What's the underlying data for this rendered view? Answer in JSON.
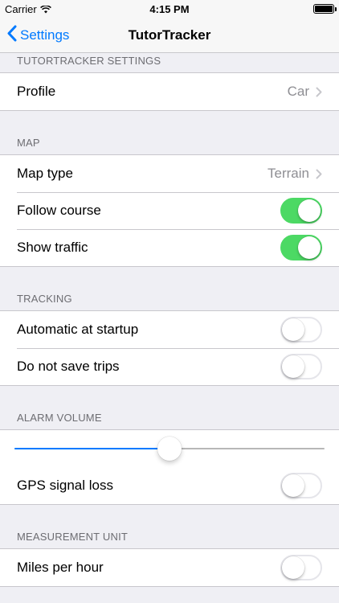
{
  "status_bar": {
    "carrier": "Carrier",
    "time": "4:15 PM"
  },
  "nav": {
    "back_label": "Settings",
    "title": "TutorTracker"
  },
  "sections": {
    "settings": {
      "header": "TUTORTRACKER SETTINGS",
      "profile": {
        "label": "Profile",
        "value": "Car"
      }
    },
    "map": {
      "header": "MAP",
      "map_type": {
        "label": "Map type",
        "value": "Terrain"
      },
      "follow_course": {
        "label": "Follow course",
        "on": true
      },
      "show_traffic": {
        "label": "Show traffic",
        "on": true
      }
    },
    "tracking": {
      "header": "TRACKING",
      "automatic_startup": {
        "label": "Automatic at startup",
        "on": false
      },
      "do_not_save": {
        "label": "Do not save trips",
        "on": false
      }
    },
    "alarm": {
      "header": "ALARM VOLUME",
      "volume": 0.5,
      "gps_loss": {
        "label": "GPS signal loss",
        "on": false
      }
    },
    "units": {
      "header": "MEASUREMENT UNIT",
      "mph": {
        "label": "Miles per hour",
        "on": false
      }
    }
  },
  "colors": {
    "accent": "#007aff",
    "switch_on": "#4cd964",
    "background": "#efeff4",
    "secondary_text": "#8e8e93"
  }
}
